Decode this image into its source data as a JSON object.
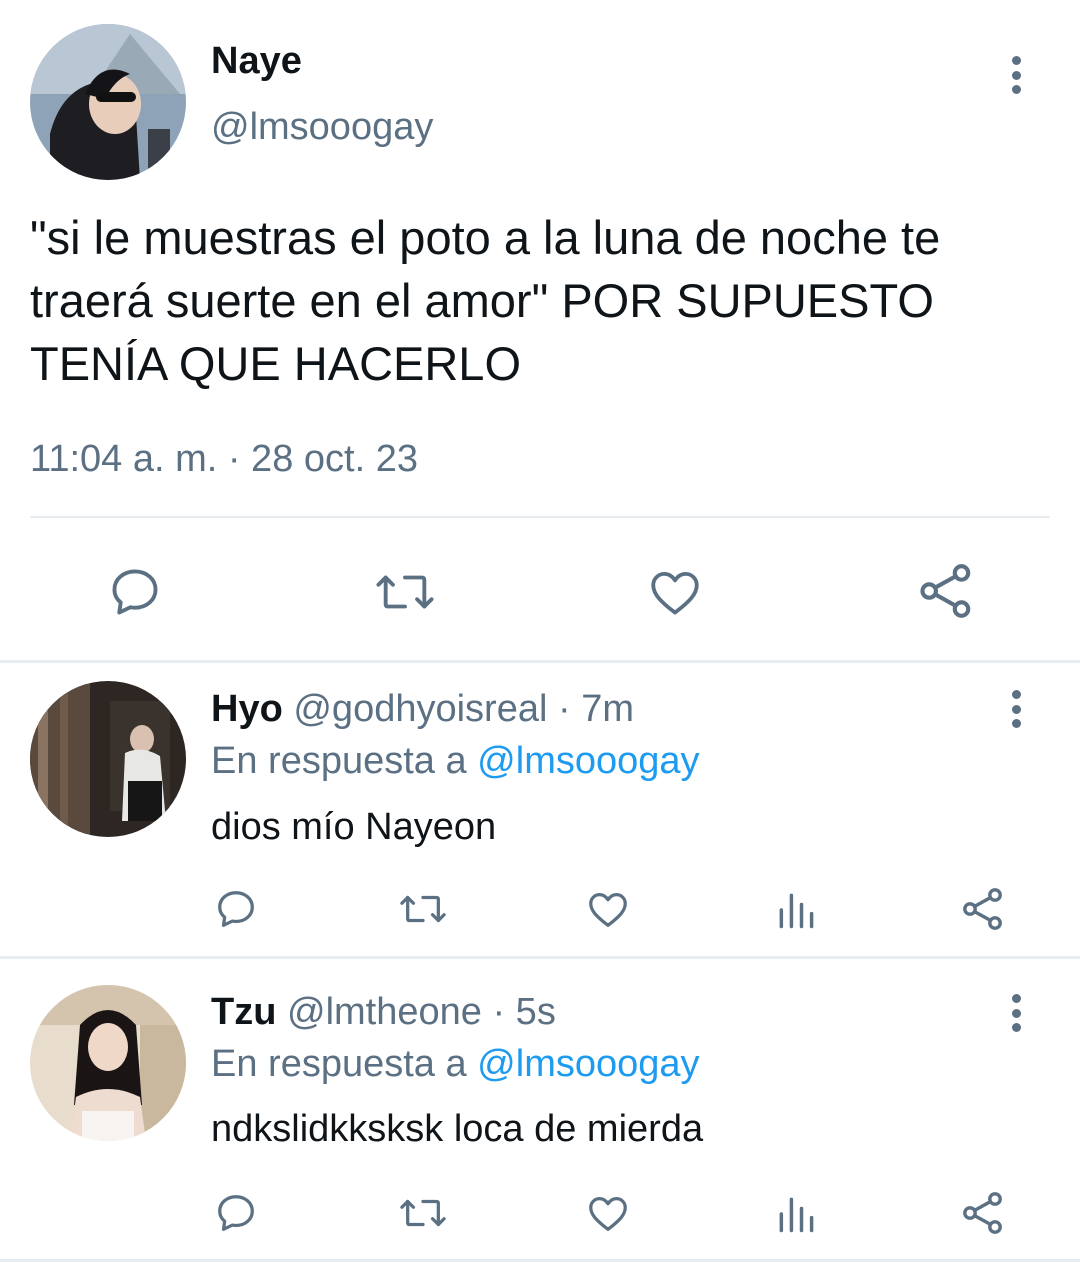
{
  "main_tweet": {
    "author_name": "Naye",
    "handle": "@lmsooogay",
    "text": "\"si le muestras el poto a la luna de noche te traerá suerte en el amor\" POR SUPUESTO TENÍA QUE HACERLO",
    "timestamp": "11:04 a. m. · 28 oct. 23"
  },
  "replies": [
    {
      "author_name": "Hyo",
      "handle": "@godhyoisreal",
      "time": "· 7m",
      "reply_prefix": "En respuesta a",
      "reply_to": "@lmsooogay",
      "text": "dios mío Nayeon"
    },
    {
      "author_name": "Tzu",
      "handle": "@lmtheone",
      "time": "· 5s",
      "reply_prefix": "En respuesta a",
      "reply_to": "@lmsooogay",
      "text": "ndkslidkksksk loca de mierda"
    }
  ],
  "colors": {
    "text": "#0f1419",
    "muted": "#5b7083",
    "link": "#1d9bf0",
    "divider": "#e6ecf0"
  },
  "icons": [
    "reply-icon",
    "retweet-icon",
    "like-icon",
    "share-icon",
    "analytics-icon",
    "more-options-icon"
  ]
}
